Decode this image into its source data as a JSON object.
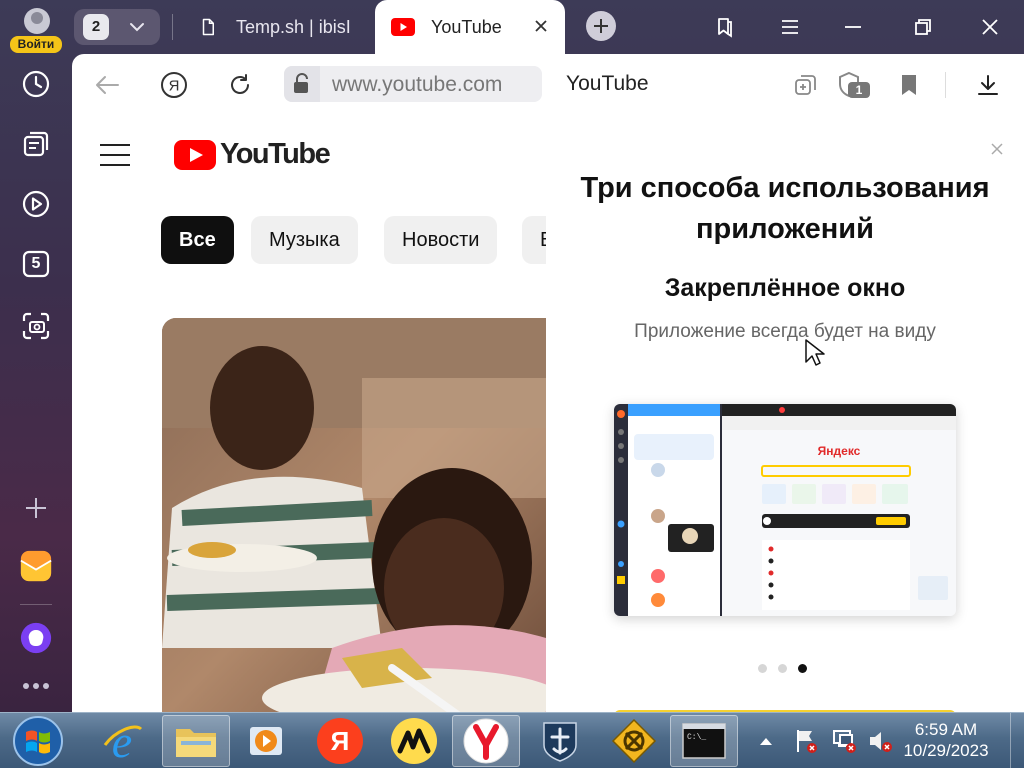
{
  "profile": {
    "login_label": "Войти"
  },
  "tabs": {
    "count": "2",
    "items": [
      {
        "title": "Temp.sh | ibisI",
        "state": "inactive",
        "icon": "document-icon"
      },
      {
        "title": "YouTube",
        "state": "active",
        "icon": "youtube-icon"
      }
    ]
  },
  "addressbar": {
    "url": "www.youtube.com",
    "page_title": "YouTube",
    "shield_badge_count": "1"
  },
  "sidebar": {
    "icons": [
      "history-icon",
      "collections-icon",
      "play-icon",
      "five-icon",
      "screenshot-icon",
      "add-icon",
      "mail-icon",
      "alice-icon",
      "more-icon"
    ],
    "badge_five": "5"
  },
  "youtube": {
    "logo_text": "YouTube",
    "chips": [
      "Все",
      "Музыка",
      "Новости",
      "В"
    ]
  },
  "promo": {
    "title": "Три способа использования приложений",
    "subtitle": "Закреплённое окно",
    "description": "Приложение всегда будет на виду",
    "preview_brand": "Яндекс",
    "pagination": {
      "total": 3,
      "current": 3
    }
  },
  "taskbar": {
    "apps": [
      "start-button",
      "internet-explorer-icon",
      "file-explorer-icon",
      "media-player-icon",
      "yandex-icon",
      "yandex-music-icon",
      "yandex-browser-icon",
      "world-of-warships-icon",
      "game-icon",
      "cmd-icon"
    ],
    "time": "6:59 AM",
    "date": "10/29/2023"
  },
  "colors": {
    "accent_yellow": "#f5c518",
    "youtube_red": "#ff0000",
    "chip_active": "#0f0f0f"
  }
}
